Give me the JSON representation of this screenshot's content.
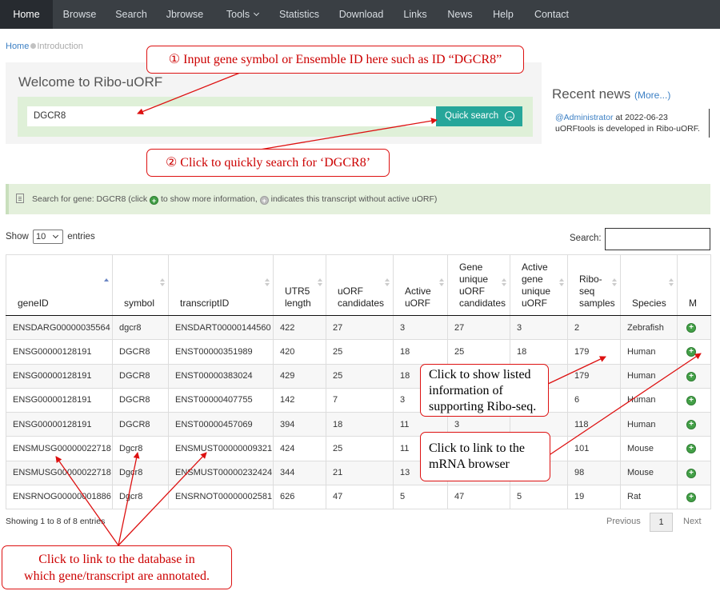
{
  "nav": {
    "items": [
      "Home",
      "Browse",
      "Search",
      "Jbrowse",
      "Tools",
      "Statistics",
      "Download",
      "Links",
      "News",
      "Help",
      "Contact"
    ]
  },
  "breadcrumb": {
    "home": "Home",
    "current": "Introduction"
  },
  "welcome": "Welcome to Ribo-uORF",
  "search": {
    "value": "DGCR8",
    "button": "Quick search"
  },
  "news": {
    "title": "Recent news",
    "more": "(More...)",
    "author": "@Administrator",
    "date_text": " at 2022-06-23",
    "item": "uORFtools is developed in Ribo-uORF."
  },
  "info": {
    "part1": "Search for gene: DGCR8 (click ",
    "part2": " to show more information, ",
    "part3": " indicates this transcript without active uORF)"
  },
  "length": {
    "show": "Show",
    "value": "10",
    "entries": "entries"
  },
  "table_search_label": "Search:",
  "columns": [
    "geneID",
    "symbol",
    "transcriptID",
    "UTR5 length",
    "uORF candidates",
    "Active uORF",
    "Gene unique uORF candidates",
    "Active gene unique uORF",
    "Ribo-seq samples",
    "Species",
    "M"
  ],
  "rows": [
    {
      "gene": "ENSDARG00000035564",
      "symbol": "dgcr8",
      "tx": "ENSDART00000144560",
      "utr5": "422",
      "cand": "27",
      "active": "3",
      "gcand": "27",
      "gactive": "3",
      "ribo": "2",
      "species": "Zebrafish"
    },
    {
      "gene": "ENSG00000128191",
      "symbol": "DGCR8",
      "tx": "ENST00000351989",
      "utr5": "420",
      "cand": "25",
      "active": "18",
      "gcand": "25",
      "gactive": "18",
      "ribo": "179",
      "species": "Human"
    },
    {
      "gene": "ENSG00000128191",
      "symbol": "DGCR8",
      "tx": "ENST00000383024",
      "utr5": "429",
      "cand": "25",
      "active": "18",
      "gcand": "",
      "gactive": "",
      "ribo": "179",
      "species": "Human"
    },
    {
      "gene": "ENSG00000128191",
      "symbol": "DGCR8",
      "tx": "ENST00000407755",
      "utr5": "142",
      "cand": "7",
      "active": "3",
      "gcand": "",
      "gactive": "",
      "ribo": "6",
      "species": "Human"
    },
    {
      "gene": "ENSG00000128191",
      "symbol": "DGCR8",
      "tx": "ENST00000457069",
      "utr5": "394",
      "cand": "18",
      "active": "11",
      "gcand": "3",
      "gactive": "",
      "ribo": "118",
      "species": "Human"
    },
    {
      "gene": "ENSMUSG00000022718",
      "symbol": "Dgcr8",
      "tx": "ENSMUST00000009321",
      "utr5": "424",
      "cand": "25",
      "active": "11",
      "gcand": "",
      "gactive": "",
      "ribo": "101",
      "species": "Mouse"
    },
    {
      "gene": "ENSMUSG00000022718",
      "symbol": "Dgcr8",
      "tx": "ENSMUST00000232424",
      "utr5": "344",
      "cand": "21",
      "active": "13",
      "gcand": "",
      "gactive": "",
      "ribo": "98",
      "species": "Mouse"
    },
    {
      "gene": "ENSRNOG00000001886",
      "symbol": "Dgcr8",
      "tx": "ENSRNOT00000002581",
      "utr5": "626",
      "cand": "47",
      "active": "5",
      "gcand": "47",
      "gactive": "5",
      "ribo": "19",
      "species": "Rat"
    }
  ],
  "footer": {
    "showing": "Showing 1 to 8 of 8 entries",
    "previous": "Previous",
    "page": "1",
    "next": "Next"
  },
  "callouts": {
    "c1": "① Input gene symbol or Ensemble ID here such as ID “DGCR8”",
    "c2": "② Click to quickly search for ‘DGCR8’",
    "c3_1": "Click to show listed",
    "c3_2": "information of",
    "c3_3": "supporting Ribo-seq.",
    "c4_1": "Click to link to the",
    "c4_2": "mRNA browser",
    "c5_1": "Click to link to the database in",
    "c5_2": "which gene/transcript are annotated."
  }
}
